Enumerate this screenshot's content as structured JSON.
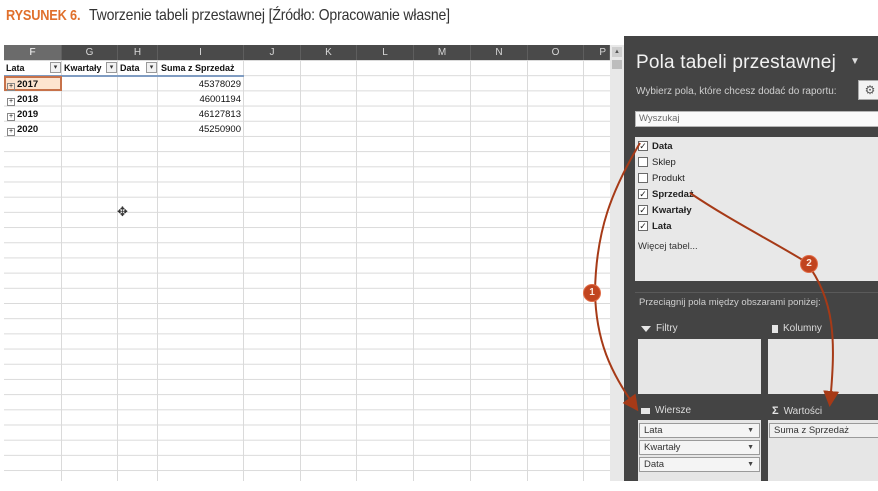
{
  "caption": {
    "figure": "RYSUNEK 6.",
    "text": "Tworzenie tabeli przestawnej [Źródło: Opracowanie własne]"
  },
  "sheet": {
    "columns": [
      "F",
      "G",
      "H",
      "I",
      "J",
      "K",
      "L",
      "M",
      "N",
      "O",
      "P"
    ],
    "headers": {
      "lata": "Lata",
      "kwartaly": "Kwartały",
      "data": "Data",
      "suma": "Suma z Sprzedaż"
    },
    "rows": [
      {
        "year": "2017",
        "value": "45378029"
      },
      {
        "year": "2018",
        "value": "46001194"
      },
      {
        "year": "2019",
        "value": "46127813"
      },
      {
        "year": "2020",
        "value": "45250900"
      }
    ]
  },
  "pane": {
    "title": "Pola tabeli przestawnej",
    "subtitle": "Wybierz pola, które chcesz dodać do raportu:",
    "search_placeholder": "Wyszukaj",
    "fields": [
      {
        "label": "Data",
        "checked": true
      },
      {
        "label": "Sklep",
        "checked": false
      },
      {
        "label": "Produkt",
        "checked": false
      },
      {
        "label": "Sprzedaż",
        "checked": true
      },
      {
        "label": "Kwartały",
        "checked": true
      },
      {
        "label": "Lata",
        "checked": true
      }
    ],
    "more_tables": "Więcej tabel...",
    "drag_hint": "Przeciągnij pola między obszarami poniżej:",
    "areas": {
      "filters": "Filtry",
      "columns": "Kolumny",
      "rows": "Wiersze",
      "values": "Wartości"
    },
    "row_items": [
      "Lata",
      "Kwartały",
      "Data"
    ],
    "value_items": [
      "Suma z Sprzedaż"
    ]
  },
  "annotations": {
    "badge1": "1",
    "badge2": "2",
    "arrow_color": "#a63a17"
  }
}
